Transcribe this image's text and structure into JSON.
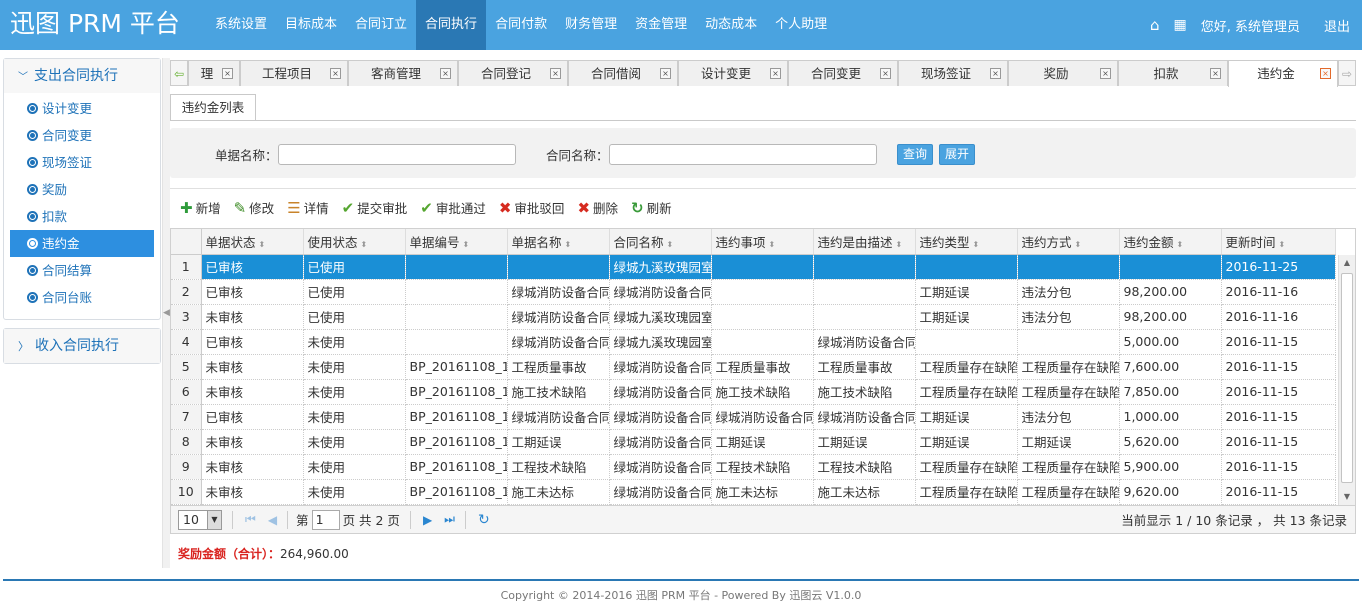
{
  "app": {
    "title": "迅图 PRM 平台"
  },
  "topnav": [
    "系统设置",
    "目标成本",
    "合同订立",
    "合同执行",
    "合同付款",
    "财务管理",
    "资金管理",
    "动态成本",
    "个人助理"
  ],
  "topnav_active": 3,
  "topright": {
    "greeting": "您好, 系统管理员",
    "logout": "退出",
    "home_icon": "home-icon",
    "grid_icon": "grid-icon"
  },
  "sidebar": {
    "group1": {
      "title": "支出合同执行",
      "items": [
        "设计变更",
        "合同变更",
        "现场签证",
        "奖励",
        "扣款",
        "违约金",
        "合同结算",
        "合同台账"
      ],
      "active": 5
    },
    "group2": {
      "title": "收入合同执行"
    }
  },
  "tabs": [
    "理",
    "工程项目",
    "客商管理",
    "合同登记",
    "合同借阅",
    "设计变更",
    "合同变更",
    "现场签证",
    "奖励",
    "扣款",
    "违约金"
  ],
  "active_tab": 10,
  "subtab": "违约金列表",
  "search": {
    "label1": "单据名称：",
    "label2": "合同名称：",
    "query_btn": "查询",
    "expand_btn": "展开",
    "value1": "",
    "value2": ""
  },
  "toolbar": [
    {
      "label": "新增",
      "icon": "plus-icon",
      "glyph": "✚",
      "color": "#2e9b3a"
    },
    {
      "label": "修改",
      "icon": "pencil-icon",
      "glyph": "✎",
      "color": "#3a8a22"
    },
    {
      "label": "详情",
      "icon": "detail-icon",
      "glyph": "☰",
      "color": "#c8832a"
    },
    {
      "label": "提交审批",
      "icon": "check-icon",
      "glyph": "✔",
      "color": "#55a630"
    },
    {
      "label": "审批通过",
      "icon": "check-icon",
      "glyph": "✔",
      "color": "#55a630"
    },
    {
      "label": "审批驳回",
      "icon": "cross-icon",
      "glyph": "✖",
      "color": "#d62b20"
    },
    {
      "label": "删除",
      "icon": "cross-icon",
      "glyph": "✖",
      "color": "#d62b20"
    },
    {
      "label": "刷新",
      "icon": "refresh-icon",
      "glyph": "↻",
      "color": "#3a9a3a"
    }
  ],
  "table": {
    "columns": [
      "单据状态",
      "使用状态",
      "单据编号",
      "单据名称",
      "合同名称",
      "违约事项",
      "违约是由描述",
      "违约类型",
      "违约方式",
      "违约金额",
      "更新时间"
    ],
    "rows": [
      [
        "1",
        "已审核",
        "已使用",
        "",
        "",
        "绿城九溪玫瑰园室",
        "",
        "",
        "",
        "",
        "",
        "2016-11-25"
      ],
      [
        "2",
        "已审核",
        "已使用",
        "",
        "绿城消防设备合同",
        "绿城消防设备合同",
        "",
        "",
        "工期延误",
        "违法分包",
        "98,200.00",
        "2016-11-16"
      ],
      [
        "3",
        "未审核",
        "已使用",
        "",
        "绿城消防设备合同",
        "绿城九溪玫瑰园室",
        "",
        "",
        "工期延误",
        "违法分包",
        "98,200.00",
        "2016-11-16"
      ],
      [
        "4",
        "已审核",
        "未使用",
        "",
        "绿城消防设备合同",
        "绿城九溪玫瑰园室",
        "",
        "绿城消防设备合同",
        "",
        "",
        "5,000.00",
        "2016-11-15"
      ],
      [
        "5",
        "未审核",
        "未使用",
        "BP_20161108_12",
        "工程质量事故",
        "绿城消防设备合同",
        "工程质量事故",
        "工程质量事故",
        "工程质量存在缺陷",
        "工程质量存在缺陷",
        "7,600.00",
        "2016-11-15"
      ],
      [
        "6",
        "未审核",
        "未使用",
        "BP_20161108_12",
        "施工技术缺陷",
        "绿城消防设备合同",
        "施工技术缺陷",
        "施工技术缺陷",
        "工程质量存在缺陷",
        "工程质量存在缺陷",
        "7,850.00",
        "2016-11-15"
      ],
      [
        "7",
        "已审核",
        "未使用",
        "BP_20161108_12",
        "绿城消防设备合同",
        "绿城消防设备合同",
        "绿城消防设备合同",
        "绿城消防设备合同",
        "工期延误",
        "违法分包",
        "1,000.00",
        "2016-11-15"
      ],
      [
        "8",
        "未审核",
        "未使用",
        "BP_20161108_12",
        "工期延误",
        "绿城消防设备合同",
        "工期延误",
        "工期延误",
        "工期延误",
        "工期延误",
        "5,620.00",
        "2016-11-15"
      ],
      [
        "9",
        "未审核",
        "未使用",
        "BP_20161108_12",
        "工程技术缺陷",
        "绿城消防设备合同",
        "工程技术缺陷",
        "工程技术缺陷",
        "工程质量存在缺陷",
        "工程质量存在缺陷",
        "5,900.00",
        "2016-11-15"
      ],
      [
        "10",
        "未审核",
        "未使用",
        "BP_20161108_12",
        "施工未达标",
        "绿城消防设备合同",
        "施工未达标",
        "施工未达标",
        "工程质量存在缺陷",
        "工程质量存在缺陷",
        "9,620.00",
        "2016-11-15"
      ]
    ],
    "selected_row": 0
  },
  "pager": {
    "page_size": "10",
    "page_prefix": "第",
    "page": "1",
    "page_suffix": "页 共 2 页",
    "info": "当前显示 1 / 10 条记录 ， 共 13 条记录"
  },
  "total": {
    "label": "奖励金额（合计）：",
    "value": "264,960.00"
  },
  "footer": "Copyright © 2014-2016 迅图 PRM 平台 - Powered By 迅图云 V1.0.0"
}
